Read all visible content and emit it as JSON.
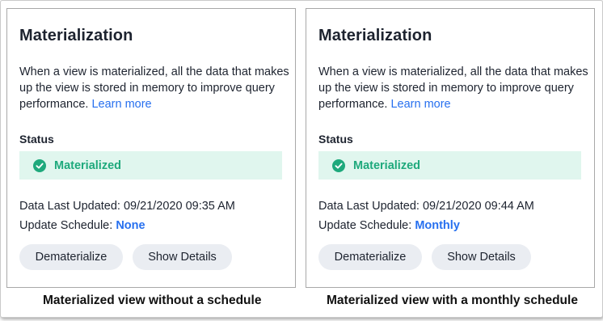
{
  "panels": [
    {
      "title": "Materialization",
      "description": "When a view is materialized, all the data that makes up the view is stored in memory to improve query performance.",
      "learn_more": "Learn more",
      "status_label": "Status",
      "status_value": "Materialized",
      "data_last_updated_label": "Data Last Updated:",
      "data_last_updated_value": "09/21/2020 09:35 AM",
      "update_schedule_label": "Update Schedule:",
      "update_schedule_value": "None",
      "dematerialize_button": "Dematerialize",
      "show_details_button": "Show Details",
      "caption": "Materialized view without a schedule"
    },
    {
      "title": "Materialization",
      "description": "When a view is materialized, all the data that makes up the view is stored in memory to improve query performance.",
      "learn_more": "Learn more",
      "status_label": "Status",
      "status_value": "Materialized",
      "data_last_updated_label": "Data Last Updated:",
      "data_last_updated_value": "09/21/2020 09:44 AM",
      "update_schedule_label": "Update Schedule:",
      "update_schedule_value": "Monthly",
      "dematerialize_button": "Dematerialize",
      "show_details_button": "Show Details",
      "caption": "Materialized view with a monthly schedule"
    }
  ],
  "icons": {
    "status": "check-circle-icon"
  },
  "colors": {
    "link": "#2770ef",
    "status_text": "#1ea97c",
    "status_bg": "#e0f6ee",
    "button_bg": "#eaedf2"
  }
}
